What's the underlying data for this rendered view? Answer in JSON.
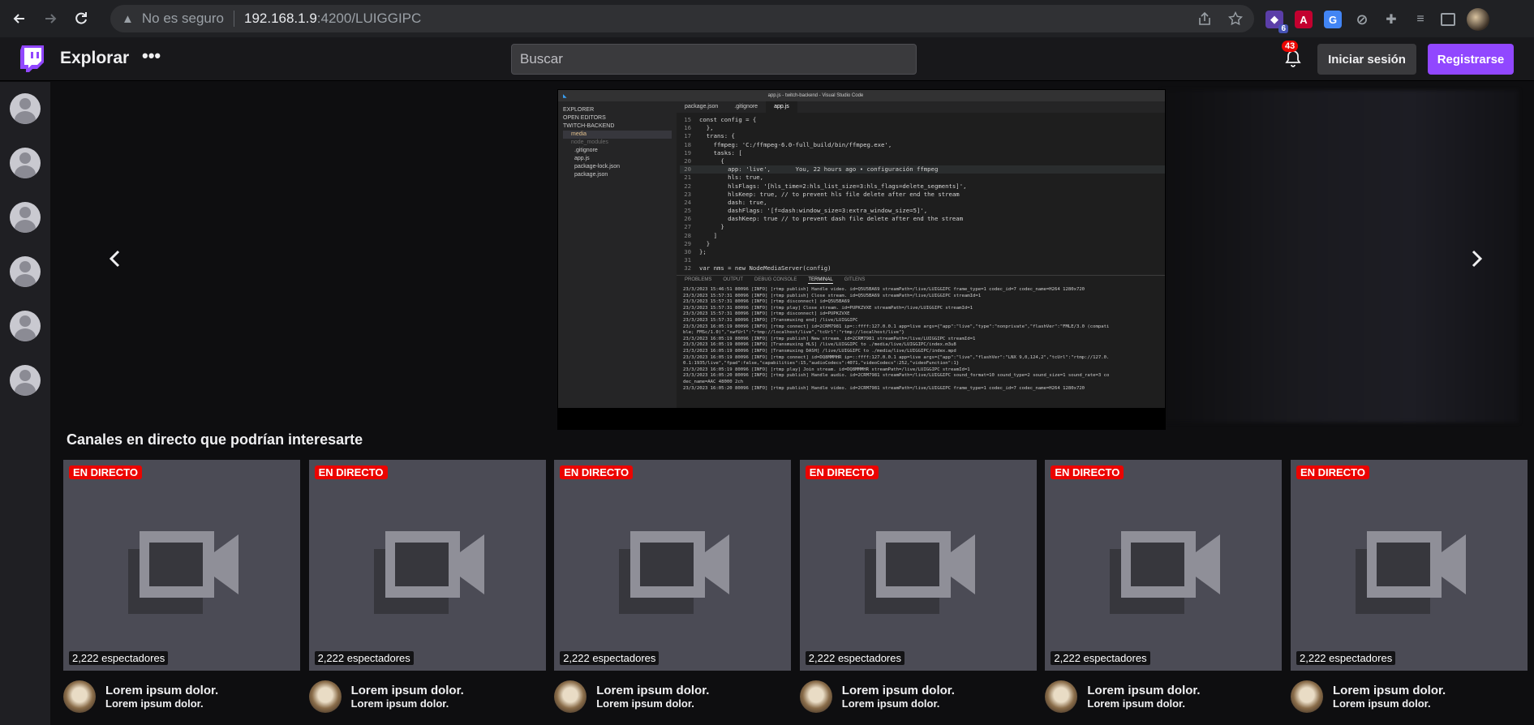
{
  "browser": {
    "security_label": "No es seguro",
    "url_host": "192.168.1.9",
    "url_rest": ":4200/LUIGGIPC",
    "extension_badge": "6"
  },
  "header": {
    "brand": "Explorar",
    "more": "•••",
    "search_placeholder": "Buscar",
    "notifications_count": "43",
    "login_label": "Iniciar sesión",
    "signup_label": "Registrarse"
  },
  "colors": {
    "brand": "#9147ff",
    "live": "#eb0400"
  },
  "sidebar": {
    "avatars": 6
  },
  "carousel": {
    "prev_icon": "chevron-left-icon",
    "next_icon": "chevron-right-icon",
    "window_title": "app.js - twitch-backend - Visual Studio Code",
    "explorer": [
      "EXPLORER",
      "OPEN EDITORS",
      "TWITCH-BACKEND",
      "media",
      "node_modules",
      ".gitignore",
      "app.js",
      "package-lock.json",
      "package.json"
    ],
    "tabs": [
      "package.json",
      ".gitignore",
      "app.js"
    ],
    "code": [
      {
        "n": "15",
        "t": "const config = {"
      },
      {
        "n": "16",
        "t": "  },"
      },
      {
        "n": "17",
        "t": "  trans: {"
      },
      {
        "n": "18",
        "t": "    ffmpeg: 'C:/ffmpeg-6.0-full_build/bin/ffmpeg.exe',"
      },
      {
        "n": "19",
        "t": "    tasks: ["
      },
      {
        "n": "20",
        "t": "      {"
      },
      {
        "n": "20",
        "t": "        app: 'live',       You, 22 hours ago • configuración ffmpeg"
      },
      {
        "n": "21",
        "t": "        hls: true,"
      },
      {
        "n": "22",
        "t": "        hlsFlags: '[hls_time=2:hls_list_size=3:hls_flags=delete_segments]',"
      },
      {
        "n": "23",
        "t": "        hlsKeep: true, // to prevent hls file delete after end the stream"
      },
      {
        "n": "24",
        "t": "        dash: true,"
      },
      {
        "n": "25",
        "t": "        dashFlags: '[f=dash:window_size=3:extra_window_size=5]',"
      },
      {
        "n": "26",
        "t": "        dashKeep: true // to prevent dash file delete after end the stream"
      },
      {
        "n": "27",
        "t": "      }"
      },
      {
        "n": "28",
        "t": "    ]"
      },
      {
        "n": "29",
        "t": "  }"
      },
      {
        "n": "30",
        "t": "};"
      },
      {
        "n": "31",
        "t": ""
      },
      {
        "n": "32",
        "t": "var nms = new NodeMediaServer(config)"
      }
    ],
    "panel_tabs": [
      "PROBLEMS",
      "OUTPUT",
      "DEBUG CONSOLE",
      "TERMINAL",
      "GITLENS"
    ],
    "terminal": [
      "23/3/2023 15:46:51 80096 [INFO] [rtmp publish] Handle video. id=Q5U5BA69 streamPath=/live/LUIGGIPC frame_type=1 codec_id=7 codec_name=H264 1280x720",
      "23/3/2023 15:57:31 80096 [INFO] [rtmp publish] Close stream. id=Q5U5BA69 streamPath=/live/LUIGGIPC streamId=1",
      "23/3/2023 15:57:31 80096 [INFO] [rtmp disconnect] id=Q5U5BA69",
      "23/3/2023 15:57:31 80096 [INFO] [rtmp play] Close stream. id=PUPKZVXE streamPath=/live/LUIGGIPC streamId=1",
      "23/3/2023 15:57:31 80096 [INFO] [rtmp disconnect] id=PUPKZVXE",
      "23/3/2023 15:57:31 80096 [INFO] [Transmuxing end] /live/LUIGGIPC",
      "23/3/2023 16:05:19 80096 [INFO] [rtmp connect] id=2CRM7981 ip=::ffff:127.0.0.1 app=live args={\"app\":\"live\",\"type\":\"nonprivate\",\"flashVer\":\"FMLE/3.0 (compati",
      "ble; FMSc/1.0)\",\"swfUrl\":\"rtmp://localhost/live\",\"tcUrl\":\"rtmp://localhost/live\"}",
      "23/3/2023 16:05:19 80096 [INFO] [rtmp publish] New stream. id=2CRM7981 streamPath=/live/LUIGGIPC streamId=1",
      "23/3/2023 16:05:19 80096 [INFO] [Transmuxing HLS] /live/LUIGGIPC to ./media/live/LUIGGIPC/index.m3u8",
      "23/3/2023 16:05:19 80096 [INFO] [Transmuxing DASH] /live/LUIGGIPC to ./media/live/LUIGGIPC/index.mpd",
      "23/3/2023 16:05:19 80096 [INFO] [rtmp connect] id=DQ8MMMHR ip=::ffff:127.0.0.1 app=live args={\"app\":\"live\",\"flashVer\":\"LNX 9,0,124,2\",\"tcUrl\":\"rtmp://127.0.",
      "0.1:1935/live\",\"fpad\":false,\"capabilities\":15,\"audioCodecs\":4071,\"videoCodecs\":252,\"videoFunction\":1}",
      "23/3/2023 16:05:19 80096 [INFO] [rtmp play] Join stream. id=DQ8MMMHR streamPath=/live/LUIGGIPC streamId=1",
      "23/3/2023 16:05:20 80096 [INFO] [rtmp publish] Handle audio. id=2CRM7981 streamPath=/live/LUIGGIPC sound_format=10 sound_type=2 sound_size=1 sound_rate=3 co",
      "dec_name=AAC 48000 2ch",
      "23/3/2023 16:05:20 80096 [INFO] [rtmp publish] Handle video. id=2CRM7981 streamPath=/live/LUIGGIPC frame_type=1 codec_id=7 codec_name=H264 1280x720"
    ]
  },
  "section": {
    "title": "Canales en directo que podrían interesarte"
  },
  "cards": [
    {
      "live": "EN DIRECTO",
      "viewers": "2,222 espectadores",
      "title": "Lorem ipsum dolor.",
      "subtitle": "Lorem ipsum dolor."
    },
    {
      "live": "EN DIRECTO",
      "viewers": "2,222 espectadores",
      "title": "Lorem ipsum dolor.",
      "subtitle": "Lorem ipsum dolor."
    },
    {
      "live": "EN DIRECTO",
      "viewers": "2,222 espectadores",
      "title": "Lorem ipsum dolor.",
      "subtitle": "Lorem ipsum dolor."
    },
    {
      "live": "EN DIRECTO",
      "viewers": "2,222 espectadores",
      "title": "Lorem ipsum dolor.",
      "subtitle": "Lorem ipsum dolor."
    },
    {
      "live": "EN DIRECTO",
      "viewers": "2,222 espectadores",
      "title": "Lorem ipsum dolor.",
      "subtitle": "Lorem ipsum dolor."
    },
    {
      "live": "EN DIRECTO",
      "viewers": "2,222 espectadores",
      "title": "Lorem ipsum dolor.",
      "subtitle": "Lorem ipsum dolor."
    }
  ]
}
